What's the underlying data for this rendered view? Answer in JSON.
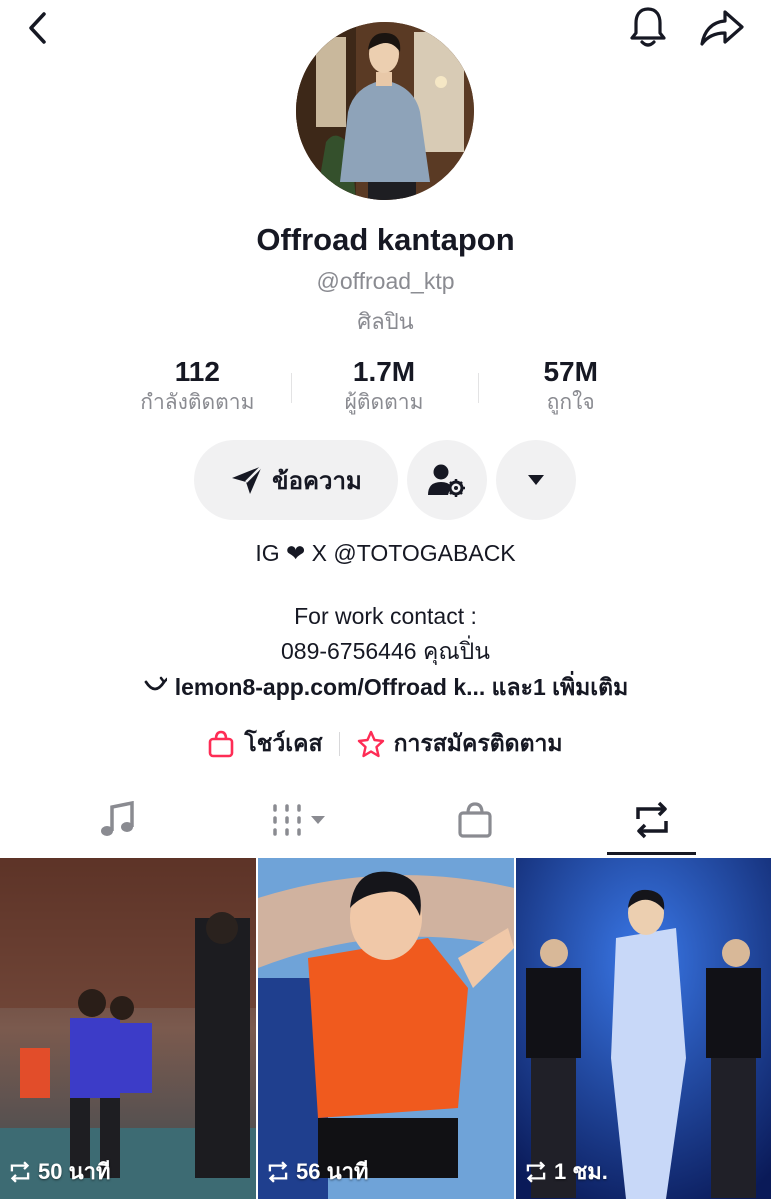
{
  "profile": {
    "name": "Offroad kantapon",
    "handle": "@offroad_ktp",
    "category": "ศิลปิน"
  },
  "stats": [
    {
      "value": "112",
      "label": "กำลังติดตาม"
    },
    {
      "value": "1.7M",
      "label": "ผู้ติดตาม"
    },
    {
      "value": "57M",
      "label": "ถูกใจ"
    }
  ],
  "actions": {
    "message_label": "ข้อความ"
  },
  "bio": {
    "line1": "IG ❤ X @TOTOGABACK",
    "line2": "For work contact :",
    "line3": "089-6756446 คุณปิ่น",
    "link": "lemon8-app.com/Offroad k... และ1 เพิ่มเติม"
  },
  "extras": {
    "showcase": "โชว์เคส",
    "subscription": "การสมัครติดตาม"
  },
  "icons": {
    "back": "back-arrow-icon",
    "bell": "bell-icon",
    "share": "share-icon",
    "add_friend": "person-gear-icon",
    "dropdown": "caret-down-icon",
    "tab_music": "music-note-icon",
    "tab_grid": "grid-icon",
    "tab_shop": "shopping-bag-icon",
    "tab_repost": "repost-icon"
  },
  "videos": [
    {
      "time": "50 นาที"
    },
    {
      "time": "56 นาที"
    },
    {
      "time": "1 ชม."
    }
  ],
  "colors": {
    "accent": "#fe2c55",
    "text": "#161823",
    "muted": "#8a8b91",
    "button_bg": "#f1f1f2"
  }
}
